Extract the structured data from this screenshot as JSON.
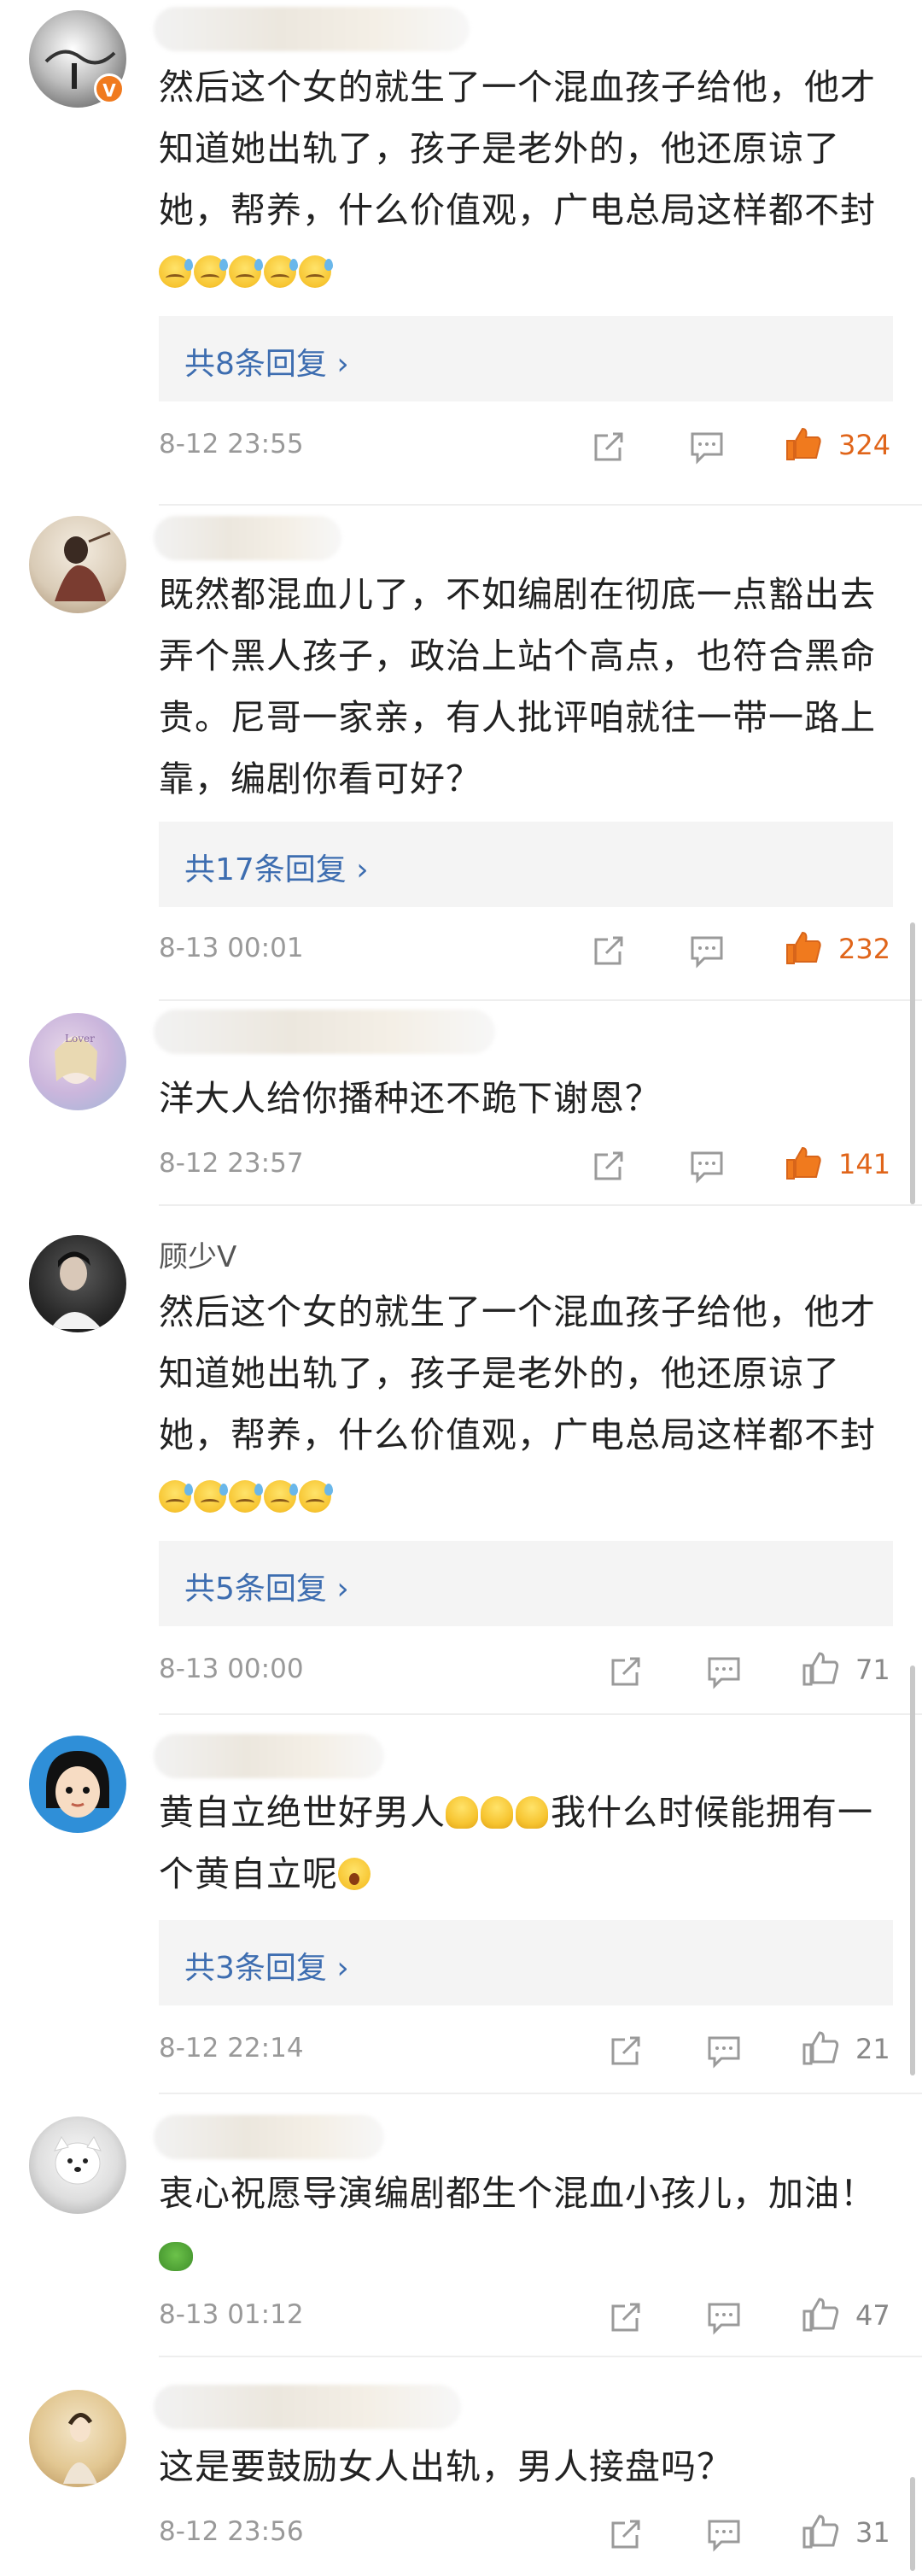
{
  "comments": [
    {
      "username": "",
      "text": "然后这个女的就生了一个混血孩子给他，他才知道她出轨了，孩子是老外的，他还原谅了她，帮养，什么价值观，广电总局这样都不封",
      "emojis": [
        "sweat-cry",
        "sweat-cry",
        "sweat-cry",
        "sweat-cry",
        "sweat-cry"
      ],
      "reply_label": "共8条回复",
      "date": "8-12 23:55",
      "likes": "324",
      "liked": true,
      "verified": true
    },
    {
      "username": "",
      "text": "既然都混血儿了，不如编剧在彻底一点豁出去弄个黑人孩子，政治上站个高点，也符合黑命贵。尼哥一家亲，有人批评咱就往一带一路上靠，编剧你看可好？",
      "emojis": [],
      "reply_label": "共17条回复",
      "date": "8-13 00:01",
      "likes": "232",
      "liked": true
    },
    {
      "username": "",
      "text": "洋大人给你播种还不跪下谢恩？",
      "emojis": [],
      "date": "8-12 23:57",
      "likes": "141",
      "liked": true
    },
    {
      "username": "顾少V",
      "text": "然后这个女的就生了一个混血孩子给他，他才知道她出轨了，孩子是老外的，他还原谅了她，帮养，什么价值观，广电总局这样都不封",
      "emojis": [
        "sweat-cry",
        "sweat-cry",
        "sweat-cry",
        "sweat-cry",
        "sweat-cry"
      ],
      "reply_label": "共5条回复",
      "date": "8-13 00:00",
      "likes": "71",
      "liked": false
    },
    {
      "username": "",
      "text_a": "黄自立绝世好男人",
      "text_b": "我什么时候能拥有一个黄自立呢",
      "reply_label": "共3条回复",
      "date": "8-12 22:14",
      "likes": "21",
      "liked": false
    },
    {
      "username": "",
      "text": "衷心祝愿导演编剧都生个混血小孩儿，加油！",
      "date": "8-13 01:12",
      "likes": "47",
      "liked": false
    },
    {
      "username": "",
      "text": "这是要鼓励女人出轨，男人接盘吗？",
      "date": "8-12 23:56",
      "likes": "31",
      "liked": false
    }
  ],
  "colors": {
    "liked": "#f07a1e",
    "like_count_liked": "#e0651a",
    "like_count": "#888888",
    "icon": "#9a9a9a",
    "reply_link": "#3d6db0"
  },
  "icons": {
    "share": "share-icon",
    "comment": "comment-icon",
    "like": "thumbs-up-icon",
    "reply_arrow": "chevron-right-icon"
  }
}
